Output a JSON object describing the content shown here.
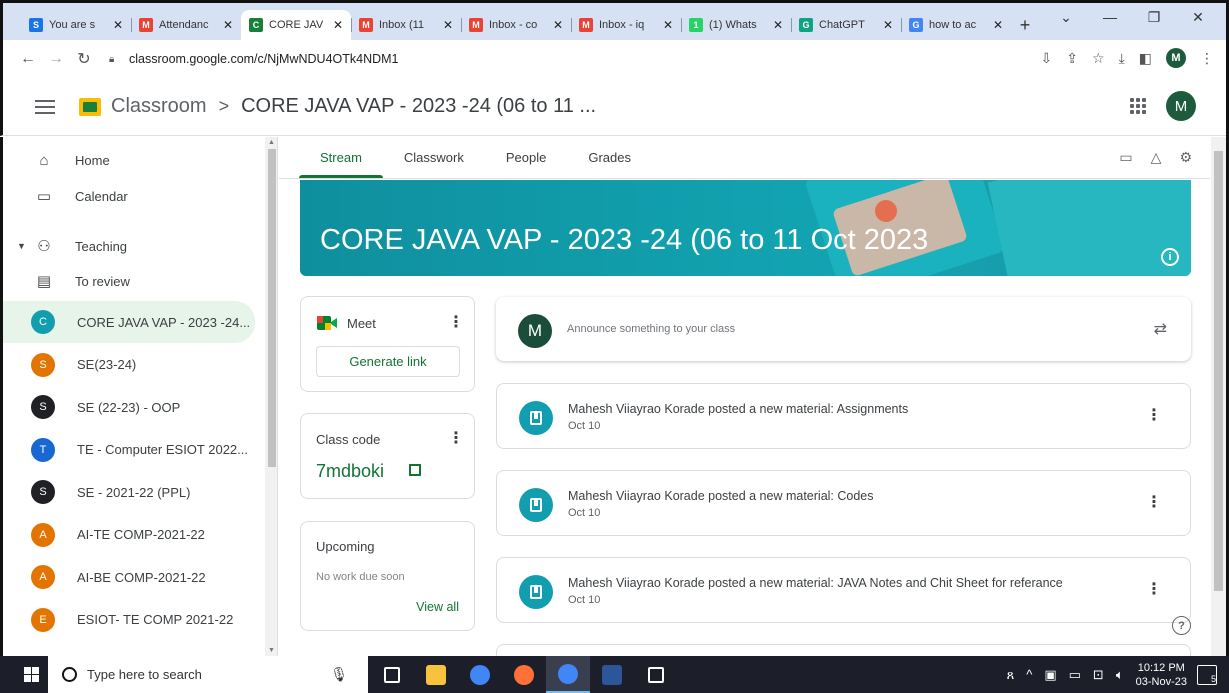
{
  "browser": {
    "tabs": [
      {
        "label": "You are s",
        "favicon": "S",
        "favicon_color": "#1a73e8",
        "active": false
      },
      {
        "label": "Attendanc",
        "favicon": "M",
        "favicon_color": "#ea4335",
        "active": false
      },
      {
        "label": "CORE JAV",
        "favicon": "C",
        "favicon_color": "#188038",
        "active": true
      },
      {
        "label": "Inbox (11",
        "favicon": "M",
        "favicon_color": "#ea4335",
        "active": false
      },
      {
        "label": "Inbox - co",
        "favicon": "M",
        "favicon_color": "#ea4335",
        "active": false
      },
      {
        "label": "Inbox - iq",
        "favicon": "M",
        "favicon_color": "#ea4335",
        "active": false
      },
      {
        "label": "(1) Whats",
        "favicon": "1",
        "favicon_color": "#25d366",
        "active": false
      },
      {
        "label": "ChatGPT",
        "favicon": "G",
        "favicon_color": "#10a37f",
        "active": false
      },
      {
        "label": "how to ac",
        "favicon": "G",
        "favicon_color": "#4285f4",
        "active": false
      }
    ],
    "new_tab": "+",
    "url": "classroom.google.com/c/NjMwNDU4OTk4NDM1",
    "profile_initial": "M"
  },
  "header": {
    "app_name": "Classroom",
    "separator": ">",
    "course_title": "CORE JAVA VAP - 2023 -24 (06 to 11 ...",
    "avatar_initial": "M"
  },
  "sidebar": {
    "nav": [
      {
        "label": "Home",
        "icon": "home-icon"
      },
      {
        "label": "Calendar",
        "icon": "calendar-icon"
      },
      {
        "label": "Teaching",
        "icon": "people-icon"
      },
      {
        "label": "To review",
        "icon": "folder-icon"
      }
    ],
    "classes": [
      {
        "initial": "C",
        "label": "CORE JAVA VAP - 2023 -24...",
        "color": "#129eaf",
        "active": true
      },
      {
        "initial": "S",
        "label": "SE(23-24)",
        "color": "#e37400"
      },
      {
        "initial": "S",
        "label": "SE (22-23) - OOP",
        "color": "#202124"
      },
      {
        "initial": "T",
        "label": "TE - Computer ESIOT 2022...",
        "color": "#1967d2"
      },
      {
        "initial": "S",
        "label": "SE - 2021-22 (PPL)",
        "color": "#202124"
      },
      {
        "initial": "A",
        "label": "AI-TE COMP-2021-22",
        "color": "#e37400"
      },
      {
        "initial": "A",
        "label": "AI-BE COMP-2021-22",
        "color": "#e37400"
      },
      {
        "initial": "E",
        "label": "ESIOT- TE COMP 2021-22",
        "color": "#e37400"
      }
    ]
  },
  "tabs": [
    {
      "label": "Stream",
      "active": true
    },
    {
      "label": "Classwork"
    },
    {
      "label": "People"
    },
    {
      "label": "Grades"
    }
  ],
  "banner": {
    "title": "CORE JAVA VAP - 2023 -24 (06 to 11 Oct 2023"
  },
  "meet": {
    "label": "Meet",
    "button": "Generate link"
  },
  "class_code": {
    "label": "Class code",
    "value": "7mdboki"
  },
  "upcoming": {
    "label": "Upcoming",
    "empty": "No work due soon",
    "link": "View all"
  },
  "announce": {
    "avatar_initial": "M",
    "placeholder": "Announce something to your class"
  },
  "posts": [
    {
      "text": "Mahesh Viiayrao Korade posted a new material: Assignments",
      "date": "Oct 10"
    },
    {
      "text": "Mahesh Viiayrao Korade posted a new material: Codes",
      "date": "Oct 10"
    },
    {
      "text": "Mahesh Viiayrao Korade posted a new material: JAVA Notes and Chit Sheet for referance",
      "date": "Oct 10"
    }
  ],
  "taskbar": {
    "search_placeholder": "Type here to search",
    "time": "10:12 PM",
    "date": "03-Nov-23",
    "notification_count": "5",
    "pinned": [
      {
        "name": "task-view-icon",
        "color": "#ffffff"
      },
      {
        "name": "file-explorer-icon",
        "color": "#f8c33c"
      },
      {
        "name": "chrome-icon",
        "color": "#4285f4"
      },
      {
        "name": "firefox-icon",
        "color": "#ff7139"
      },
      {
        "name": "chrome-icon",
        "color": "#4285f4",
        "active": true
      },
      {
        "name": "word-icon",
        "color": "#2b579a"
      },
      {
        "name": "photos-icon",
        "color": "#ffffff"
      }
    ]
  }
}
